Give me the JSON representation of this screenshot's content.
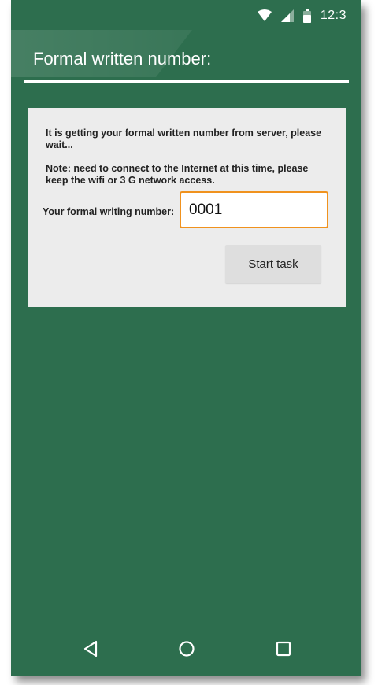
{
  "status_bar": {
    "time": "12:3",
    "icons": [
      "wifi-icon",
      "cell-signal-icon",
      "battery-icon"
    ]
  },
  "app": {
    "title": "Formal written number:"
  },
  "card": {
    "message_loading": "It is getting your formal written number from server, please wait...",
    "message_note": "Note: need to connect to the Internet at this time, please keep the wifi or 3 G network access.",
    "number_label": "Your formal writing number:",
    "number_value": "0001",
    "start_button_label": "Start task"
  },
  "nav_bar": {
    "icons": [
      "back-icon",
      "home-icon",
      "recents-icon"
    ]
  },
  "colors": {
    "background": "#2d6e4e",
    "card": "#ececec",
    "input_focus_border": "#f0921e",
    "button": "#dedede"
  }
}
